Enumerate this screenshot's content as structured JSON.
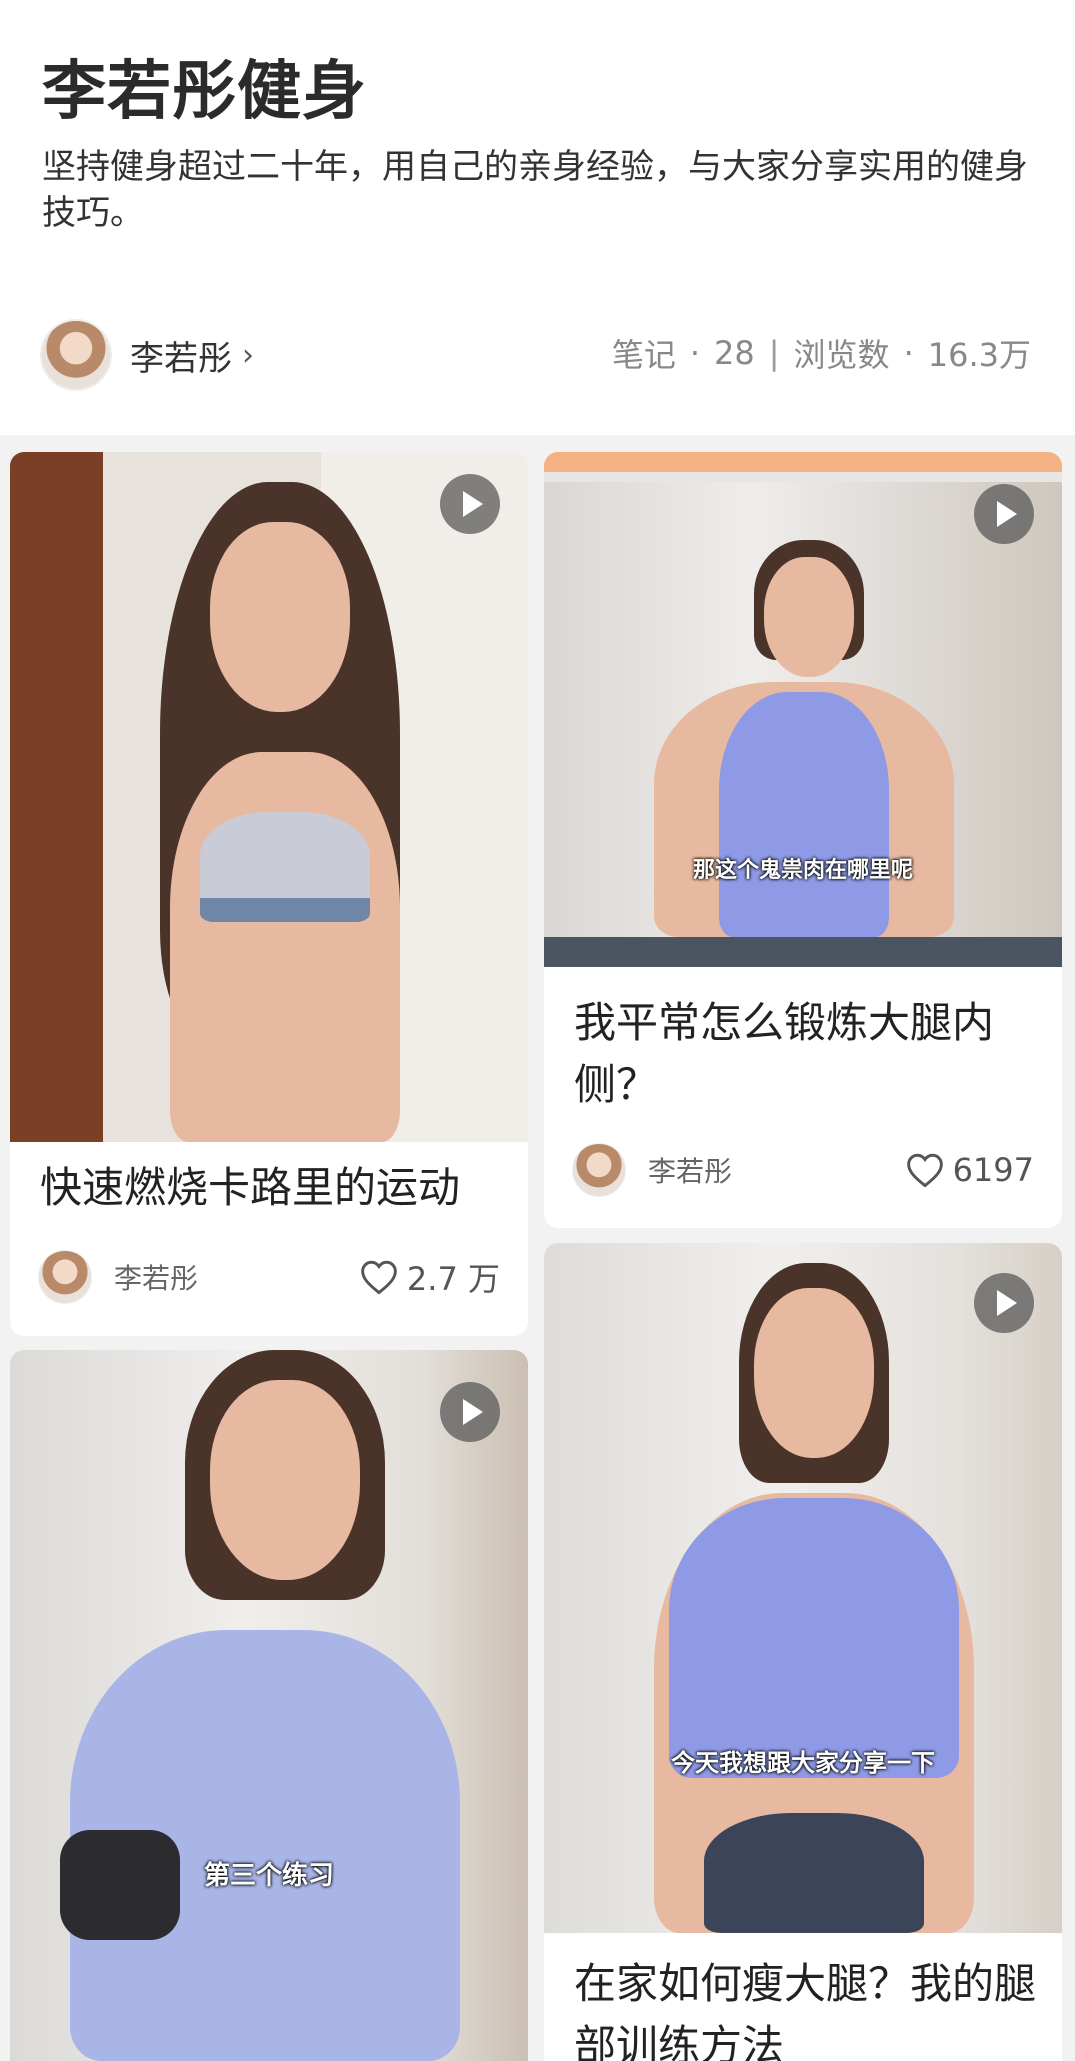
{
  "profile": {
    "title": "李若彤健身",
    "description": "坚持健身超过二十年，用自己的亲身经验，与大家分享实用的健身技巧。",
    "author": "李若彤",
    "chevron": "›",
    "notes_label": "笔记",
    "notes_count": "28",
    "views_label": "浏览数",
    "views_count": "16.3万",
    "dot": "·",
    "divider": "|"
  },
  "cards": [
    {
      "title": "快速燃烧卡路里的运动",
      "author": "李若彤",
      "likes": "2.7 万",
      "caption": ""
    },
    {
      "title": "我平常怎么锻炼大腿内侧？",
      "author": "李若彤",
      "likes": "6197",
      "caption": "那这个鬼祟肉在哪里呢"
    },
    {
      "title": "",
      "author": "",
      "likes": "",
      "caption": "第三个练习"
    },
    {
      "title": "在家如何瘦大腿？我的腿部训练方法",
      "author": "",
      "likes": "",
      "caption": "今天我想跟大家分享一下"
    }
  ],
  "icons": {
    "play": "play-icon",
    "heart": "heart-icon",
    "chevron": "chevron-right-icon"
  },
  "colors": {
    "accent_bar": "#f4b183",
    "shirt_blue": "#8e9ae6",
    "wall": "#e9e6e3"
  }
}
